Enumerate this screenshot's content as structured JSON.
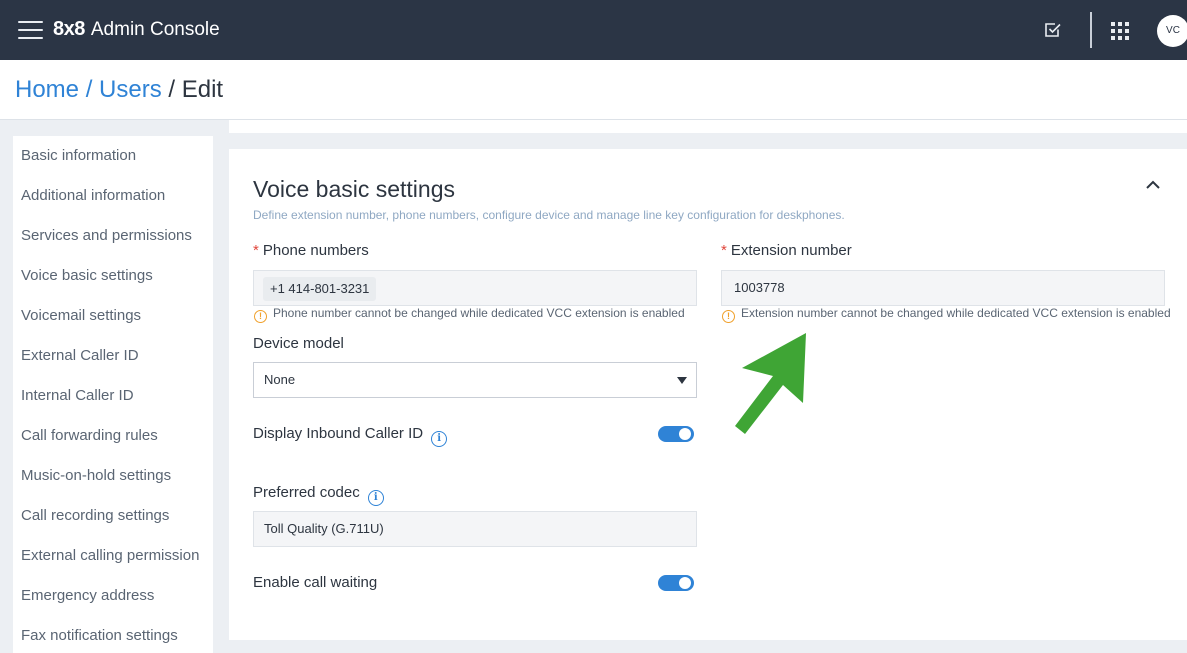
{
  "app": {
    "brand_logo": "8x8",
    "brand_title": "Admin Console",
    "avatar_initials": "VC"
  },
  "breadcrumb": {
    "home": "Home",
    "separator": " / ",
    "users": "Users",
    "current": "Edit"
  },
  "sidebar": {
    "items": [
      "Basic information",
      "Additional information",
      "Services and permissions",
      "Voice basic settings",
      "Voicemail settings",
      "External Caller ID",
      "Internal Caller ID",
      "Call forwarding rules",
      "Music-on-hold settings",
      "Call recording settings",
      "External calling permission",
      "Emergency address",
      "Fax notification settings"
    ]
  },
  "section": {
    "title": "Voice basic settings",
    "subtitle": "Define extension number, phone numbers, configure device and manage line key configuration for deskphones."
  },
  "phone": {
    "required_mark": "*",
    "label": "Phone numbers",
    "value": "+1 414-801-3231",
    "warning": "Phone number cannot be changed while dedicated VCC extension is enabled"
  },
  "extension": {
    "required_mark": "*",
    "label": "Extension number",
    "value": "1003778",
    "warning": "Extension number cannot be changed while dedicated VCC extension is enabled"
  },
  "device": {
    "label": "Device model",
    "selected": "None"
  },
  "inbound_caller_id": {
    "label": "Display Inbound Caller ID",
    "enabled": true
  },
  "codec": {
    "label": "Preferred codec",
    "value": "Toll Quality (G.711U)"
  },
  "call_waiting": {
    "label": "Enable call waiting",
    "enabled": true
  },
  "icons": {
    "warning": "!",
    "info": "i"
  },
  "colors": {
    "topbar": "#2b3545",
    "accent": "#2f83d6",
    "required": "#e0463b",
    "warning": "#f0a02b",
    "annotation_arrow": "#3fa535"
  }
}
